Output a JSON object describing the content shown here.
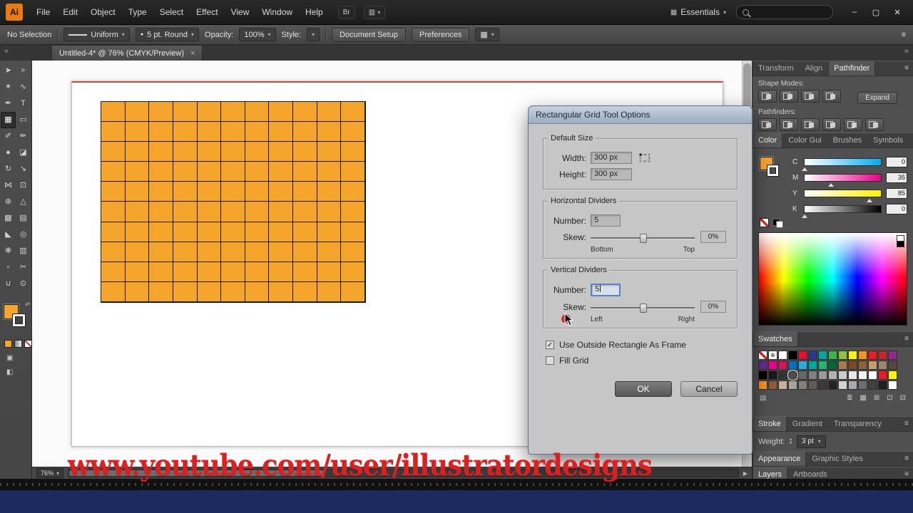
{
  "menubar": {
    "logo": "Ai",
    "items": [
      "File",
      "Edit",
      "Object",
      "Type",
      "Select",
      "Effect",
      "View",
      "Window",
      "Help"
    ],
    "workspace": "Essentials"
  },
  "icons": {
    "chevron_down": "▾",
    "minimize": "–",
    "maximize": "▢",
    "close": "✕",
    "close_tab": "×",
    "bridge": "Br",
    "arrange_documents": "▥",
    "workspace": "▦",
    "menu": "≡",
    "collapse_left": "«",
    "collapse_right": "»",
    "scroll_right": "▶",
    "swap": "⇄",
    "check": "✓",
    "caret_up": "▲",
    "caret_down": "▼",
    "dot": "●",
    "registration": "⊕",
    "draw_mode": "▣",
    "screen_mode": "◧"
  },
  "control_bar": {
    "selection_status": "No Selection",
    "stroke_profile": "Uniform",
    "brush": "5 pt. Round",
    "opacity_label": "Opacity:",
    "opacity_value": "100%",
    "style_label": "Style:",
    "document_setup": "Document Setup",
    "preferences": "Preferences"
  },
  "document_tab": {
    "title": "Untitled-4* @ 76% (CMYK/Preview)"
  },
  "toolbar": {
    "tools": [
      {
        "name": "selection-tool",
        "glyph": "➤"
      },
      {
        "name": "direct-selection-tool",
        "glyph": "➤",
        "outline": true
      },
      {
        "name": "magic-wand-tool",
        "glyph": "✶"
      },
      {
        "name": "lasso-tool",
        "glyph": "∿"
      },
      {
        "name": "pen-tool",
        "glyph": "✒"
      },
      {
        "name": "type-tool",
        "glyph": "T"
      },
      {
        "name": "rectangular-grid-tool",
        "glyph": "▦",
        "active": true
      },
      {
        "name": "rectangle-tool",
        "glyph": "▭"
      },
      {
        "name": "paintbrush-tool",
        "glyph": "✐"
      },
      {
        "name": "pencil-tool",
        "glyph": "✏"
      },
      {
        "name": "blob-brush-tool",
        "glyph": "●"
      },
      {
        "name": "eraser-tool",
        "glyph": "◪"
      },
      {
        "name": "rotate-tool",
        "glyph": "↻"
      },
      {
        "name": "scale-tool",
        "glyph": "↘"
      },
      {
        "name": "width-tool",
        "glyph": "⋈"
      },
      {
        "name": "free-transform-tool",
        "glyph": "⊡"
      },
      {
        "name": "shape-builder-tool",
        "glyph": "⊕"
      },
      {
        "name": "perspective-grid-tool",
        "glyph": "△"
      },
      {
        "name": "mesh-tool",
        "glyph": "▩"
      },
      {
        "name": "gradient-tool",
        "glyph": "▤"
      },
      {
        "name": "eyedropper-tool",
        "glyph": "◣"
      },
      {
        "name": "blend-tool",
        "glyph": "◎"
      },
      {
        "name": "symbol-sprayer-tool",
        "glyph": "❋"
      },
      {
        "name": "column-graph-tool",
        "glyph": "▥"
      },
      {
        "name": "artboard-tool",
        "glyph": "▫"
      },
      {
        "name": "slice-tool",
        "glyph": "✂"
      },
      {
        "name": "hand-tool",
        "glyph": "∪"
      },
      {
        "name": "zoom-tool",
        "glyph": "⊙"
      }
    ]
  },
  "colors": {
    "fill": "#F5A42C",
    "grid_stroke": "#1a1a1a",
    "artboard_edge": "#C94A38",
    "watermark": "#DF1F1F"
  },
  "canvas": {
    "grid": {
      "rows": 10,
      "cols": 11
    }
  },
  "dialog": {
    "title": "Rectangular Grid Tool Options",
    "default_size": {
      "legend": "Default Size",
      "width_label": "Width:",
      "width_value": "300 px",
      "height_label": "Height:",
      "height_value": "300 px"
    },
    "horizontal": {
      "legend": "Horizontal Dividers",
      "number_label": "Number:",
      "number_value": "5",
      "skew_label": "Skew:",
      "skew_value": "0%",
      "min_label": "Bottom",
      "max_label": "Top"
    },
    "vertical": {
      "legend": "Vertical Dividers",
      "number_label": "Number:",
      "number_value": "5",
      "skew_label": "Skew:",
      "skew_value": "0%",
      "min_label": "Left",
      "max_label": "Right"
    },
    "frame_checkbox_label": "Use Outside Rectangle As Frame",
    "frame_checkbox_checked": true,
    "fill_checkbox_label": "Fill Grid",
    "fill_checkbox_checked": false,
    "ok": "OK",
    "cancel": "Cancel"
  },
  "panels": {
    "groups": [
      {
        "tabs": [
          "Transform",
          "Align",
          "Pathfinder"
        ],
        "active": 2
      },
      {
        "tabs": [
          "Color",
          "Color Gui",
          "Brushes",
          "Symbols"
        ],
        "active": 0
      },
      {
        "tabs": [
          "Swatches"
        ],
        "active": 0
      },
      {
        "tabs": [
          "Stroke",
          "Gradient",
          "Transparency"
        ],
        "active": 0
      },
      {
        "tabs": [
          "Appearance",
          "Graphic Styles"
        ],
        "active": 0
      },
      {
        "tabs": [
          "Layers",
          "Artboards"
        ],
        "active": 0
      }
    ],
    "pathfinder": {
      "shape_modes_label": "Shape Modes:",
      "expand": "Expand",
      "pathfinders_label": "Pathfinders:",
      "shape_mode_icons": [
        "unite-icon",
        "minus-front-icon",
        "intersect-icon",
        "exclude-icon"
      ],
      "pathfinder_icons": [
        "divide-icon",
        "trim-icon",
        "merge-icon",
        "crop-icon",
        "outline-icon",
        "minus-back-icon"
      ]
    },
    "color": {
      "channels": [
        {
          "label": "C",
          "value": "0",
          "percent": 0,
          "color": "#00AEEF"
        },
        {
          "label": "M",
          "value": "35",
          "percent": 35,
          "color": "#EC008C"
        },
        {
          "label": "Y",
          "value": "85",
          "percent": 85,
          "color": "#FFF200"
        },
        {
          "label": "K",
          "value": "0",
          "percent": 0,
          "color": "#000000"
        }
      ]
    },
    "swatches": {
      "cells": [
        "none",
        "registration",
        "#FFFFFF",
        "#000000",
        "#E8112D",
        "#2B3990",
        "#00A99D",
        "#39B54A",
        "#8CC63F",
        "#FFF200",
        "#F7941E",
        "#ED1C24",
        "#C1272D",
        "#93278F",
        "#662D91",
        "#EC008C",
        "#D4145A",
        "#0071BC",
        "#29ABE2",
        "#00A99D",
        "#22B573",
        "#006837",
        "#A67C52",
        "#754C24",
        "#8C6239",
        "#C69C6D",
        "#998675",
        "#534741",
        "#000000",
        "#1A1A1A",
        "#333333",
        "#4D4D4D",
        "#666666",
        "#808080",
        "#999999",
        "#B3B3B3",
        "#CCCCCC",
        "#E6E6E6",
        "#F2F2F2",
        "#FFFFFF",
        "#ED1C24",
        "#FFF200",
        "#F7931E",
        "#8B5E3C",
        "#C7B299",
        "#ACA39A",
        "#837F7D",
        "#5F5C5B",
        "#3B3835",
        "#262523",
        "#D1D3D4",
        "#A7A9AC",
        "#6D6E71",
        "#414042",
        "#231F20",
        "#FFFFFF"
      ],
      "selected_index": 31,
      "icon_names": [
        "swatch-libraries-icon",
        "swatch-kinds-icon",
        "swatch-options-icon",
        "new-color-group-icon",
        "new-swatch-icon",
        "delete-swatch-icon"
      ],
      "icon_glyphs": [
        "▤",
        "≣",
        "▦",
        "⊞",
        "⊡",
        "⊟"
      ]
    },
    "stroke": {
      "weight_label": "Weight:",
      "weight_value": "3 pt"
    }
  },
  "status_bar": {
    "zoom": "76%"
  },
  "watermark": "www.youtube.com/user/illustratordesigns"
}
